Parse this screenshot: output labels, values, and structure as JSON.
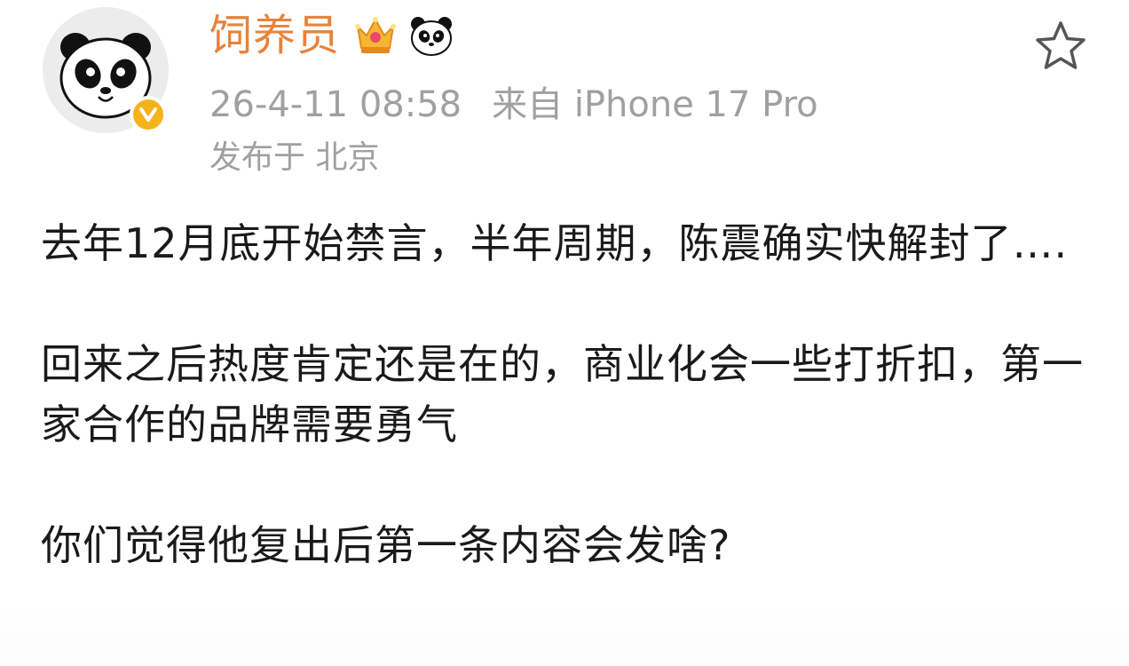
{
  "user": {
    "name": "饲养员"
  },
  "meta": {
    "timestamp": "26-4-11 08:58",
    "source": "来自 iPhone 17 Pro",
    "location": "发布于 北京"
  },
  "content": {
    "paragraphs": [
      "去年12月底开始禁言，半年周期，陈震确实快解封了….",
      "回来之后热度肯定还是在的，商业化会一些打折扣，第一家合作的品牌需要勇气",
      "你们觉得他复出后第一条内容会发啥?"
    ]
  },
  "icons": {
    "avatar": "panda-avatar",
    "verified": "verified-v-icon",
    "crown": "crown-icon",
    "panda_badge": "panda-badge-icon",
    "favorite": "star-icon"
  },
  "colors": {
    "username": "#e8833a",
    "meta": "#a0a0a0",
    "body": "#1a1a1a",
    "verified": "#f6b21b"
  }
}
